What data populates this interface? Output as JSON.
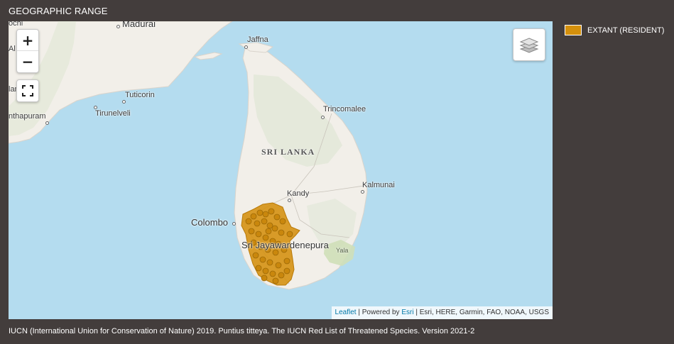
{
  "section_title": "GEOGRAPHIC RANGE",
  "map": {
    "zoom_in_label": "+",
    "zoom_out_label": "−",
    "places": {
      "madurai": "Madurai",
      "jaffna": "Jaffna",
      "tuticorin": "Tuticorin",
      "tirunelveli": "Tirunelveli",
      "thiruvananthapuram": "nthapuram",
      "alappuzha": "Al     ha",
      "kollam": "lam",
      "kochi": "ochi",
      "trincomalee": "Trincomalee",
      "sri_lanka": "SRI LANKA",
      "kandy": "Kandy",
      "kalmunai": "Kalmunai",
      "colombo": "Colombo",
      "jayawardenepura": "Sri Jayawardenepura",
      "yala": "Yala"
    },
    "attribution": {
      "leaflet": "Leaflet",
      "powered_by": "Powered by",
      "esri": "Esri",
      "sources": "Esri, HERE, Garmin, FAO, NOAA, USGS"
    },
    "range_color": "#d4900c",
    "water_color": "#b4dcef",
    "land_color": "#f2efe9"
  },
  "legend": {
    "items": [
      {
        "label": "EXTANT (RESIDENT)",
        "color": "#d4900c"
      }
    ]
  },
  "citation": "IUCN (International Union for Conservation of Nature) 2019. Puntius titteya. The IUCN Red List of Threatened Species. Version 2021-2"
}
